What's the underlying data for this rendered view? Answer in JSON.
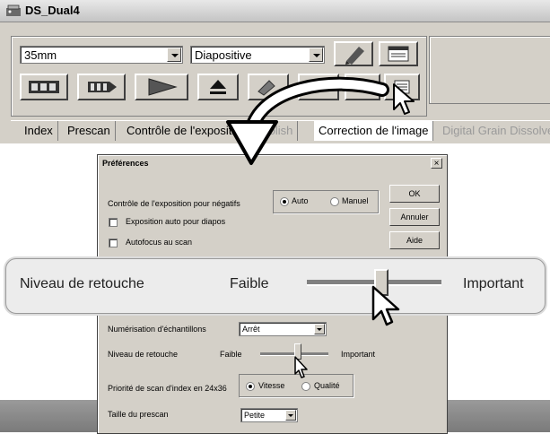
{
  "app": {
    "title": "DS_Dual4",
    "film_size": "35mm",
    "film_type": "Diapositive",
    "tabs": [
      "Index",
      "Prescan",
      "Contrôle de l'exposition",
      "Polish",
      "Correction de l'image",
      "Digital Grain Dissolver"
    ],
    "active_tab": "Correction de l'image"
  },
  "dialog": {
    "title": "Préférences",
    "close": "×",
    "buttons": {
      "ok": "OK",
      "cancel": "Annuler",
      "help": "Aide"
    },
    "neg_exposure_label": "Contrôle de l'exposition pour négatifs",
    "neg_exposure_auto": "Auto",
    "neg_exposure_manual": "Manuel",
    "auto_exposure_slides": "Exposition auto pour diapos",
    "autofocus_scan": "Autofocus au scan",
    "sampling_label": "Numérisation d'échantillons",
    "sampling_value": "Arrêt",
    "retouch_label": "Niveau de retouche",
    "retouch_low": "Faible",
    "retouch_high": "Important",
    "retouch_level": 0.55,
    "index_priority_label": "Priorité de scan d'index en 24x36",
    "index_priority_speed": "Vitesse",
    "index_priority_quality": "Qualité",
    "prescan_size_label": "Taille du prescan",
    "prescan_size_value": "Petite"
  },
  "zoom": {
    "label": "Niveau de retouche",
    "low": "Faible",
    "high": "Important"
  },
  "colors": {
    "window_bg": "#d4d0c8",
    "band": "#8a8a8a",
    "callout_bg": "#ececec"
  },
  "icons": [
    "scanner-icon",
    "filmstrip-index-icon",
    "prescan-icon",
    "scan-icon",
    "eject-icon",
    "pencil-icon",
    "preferences-icon",
    "pointer-cursor-icon",
    "curved-arrow-icon"
  ]
}
